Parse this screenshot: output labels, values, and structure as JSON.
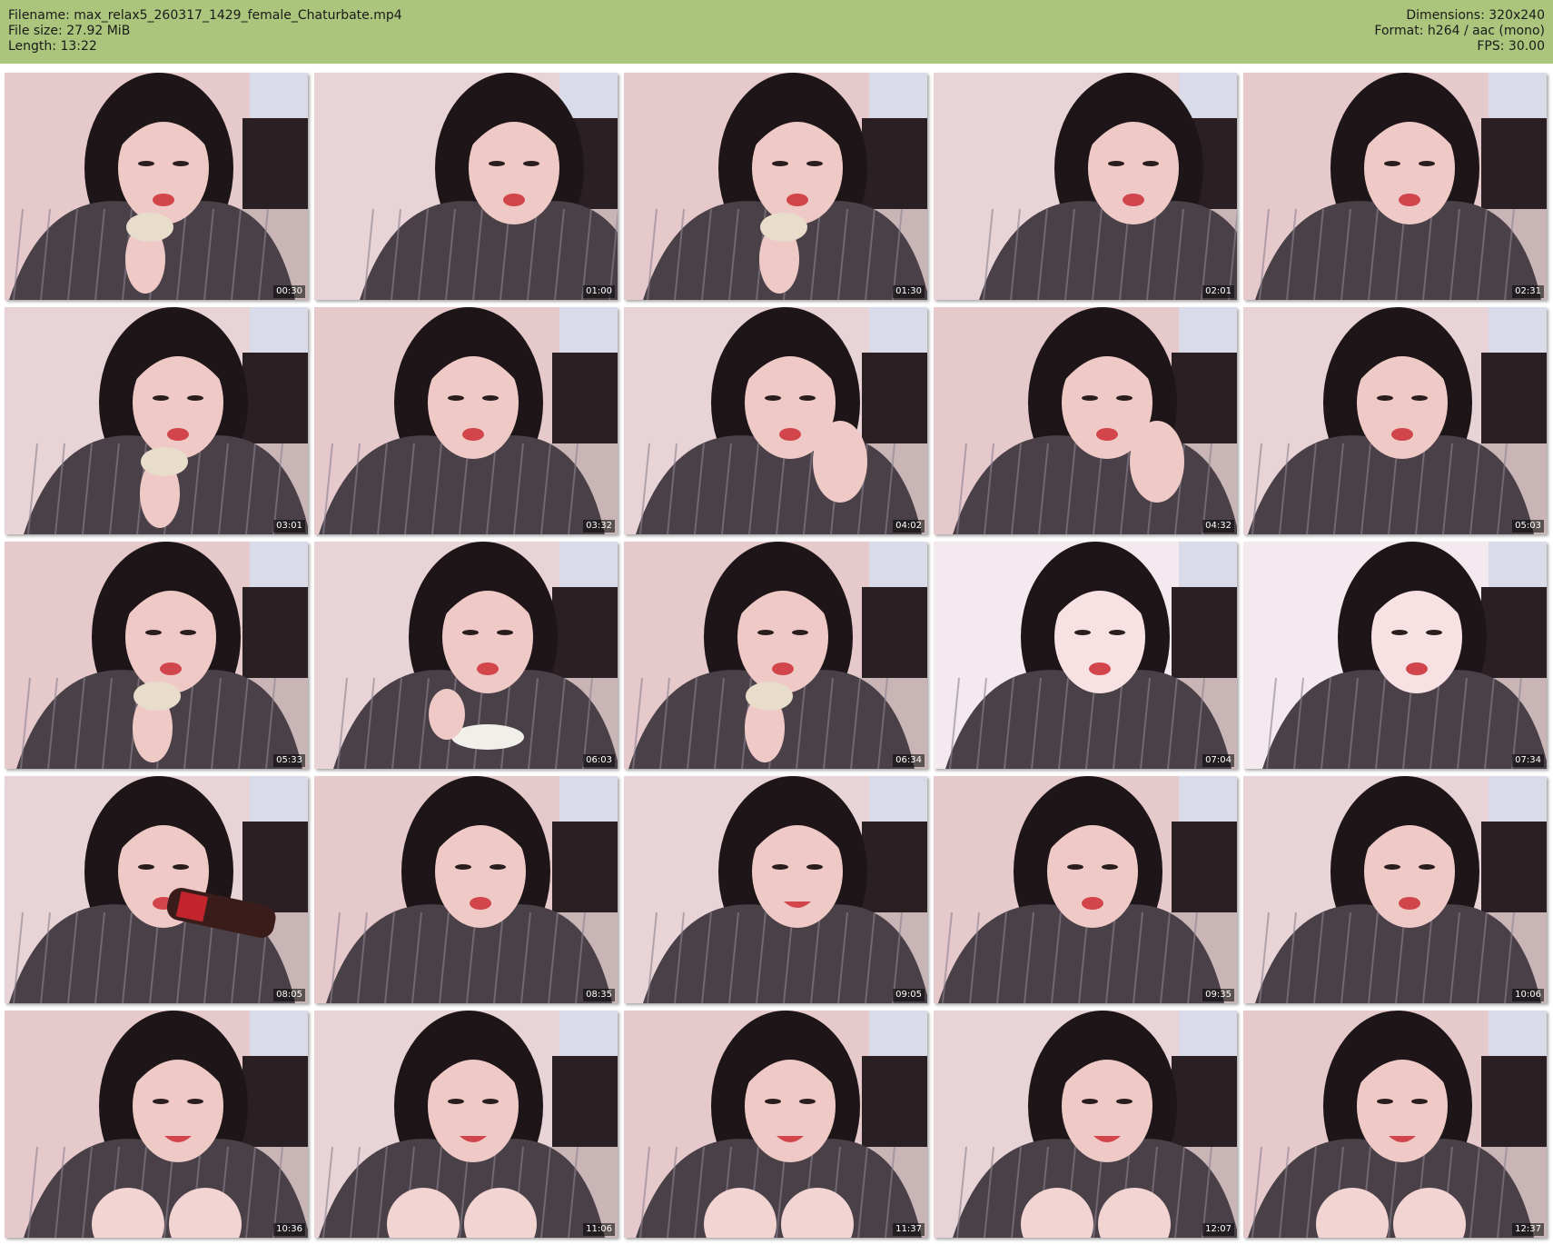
{
  "header": {
    "filename_line": "Filename: max_relax5_260317_1429_female_Chaturbate.mp4",
    "filesize_line": "File size: 27.92 MiB",
    "length_line": "Length: 13:22",
    "dimensions_line": "Dimensions: 320x240",
    "format_line": "Format: h264 / aac (mono)",
    "fps_line": "FPS: 30.00"
  },
  "colors": {
    "header_bg": "#abc57d",
    "page_bg": "#ffffff"
  },
  "thumbnails": [
    {
      "timestamp": "00:30",
      "scene": "eating-bread"
    },
    {
      "timestamp": "01:00",
      "scene": "looking-down"
    },
    {
      "timestamp": "01:30",
      "scene": "eating-bread"
    },
    {
      "timestamp": "02:01",
      "scene": "looking-down"
    },
    {
      "timestamp": "02:31",
      "scene": "pout"
    },
    {
      "timestamp": "03:01",
      "scene": "eating-bread"
    },
    {
      "timestamp": "03:32",
      "scene": "pout"
    },
    {
      "timestamp": "04:02",
      "scene": "hand-to-face"
    },
    {
      "timestamp": "04:32",
      "scene": "hand-to-face"
    },
    {
      "timestamp": "05:03",
      "scene": "pout"
    },
    {
      "timestamp": "05:33",
      "scene": "eating-bread"
    },
    {
      "timestamp": "06:03",
      "scene": "eating-soup"
    },
    {
      "timestamp": "06:34",
      "scene": "eating-bread"
    },
    {
      "timestamp": "07:04",
      "scene": "pout-bright"
    },
    {
      "timestamp": "07:34",
      "scene": "pout-bright"
    },
    {
      "timestamp": "08:05",
      "scene": "drinking-soda"
    },
    {
      "timestamp": "08:35",
      "scene": "pout"
    },
    {
      "timestamp": "09:05",
      "scene": "smiling"
    },
    {
      "timestamp": "09:35",
      "scene": "pout"
    },
    {
      "timestamp": "10:06",
      "scene": "pout"
    },
    {
      "timestamp": "10:36",
      "scene": "smiling-knees"
    },
    {
      "timestamp": "11:06",
      "scene": "smiling-knees"
    },
    {
      "timestamp": "11:37",
      "scene": "smiling-knees"
    },
    {
      "timestamp": "12:07",
      "scene": "smiling-knees"
    },
    {
      "timestamp": "12:37",
      "scene": "smiling-knees"
    }
  ]
}
